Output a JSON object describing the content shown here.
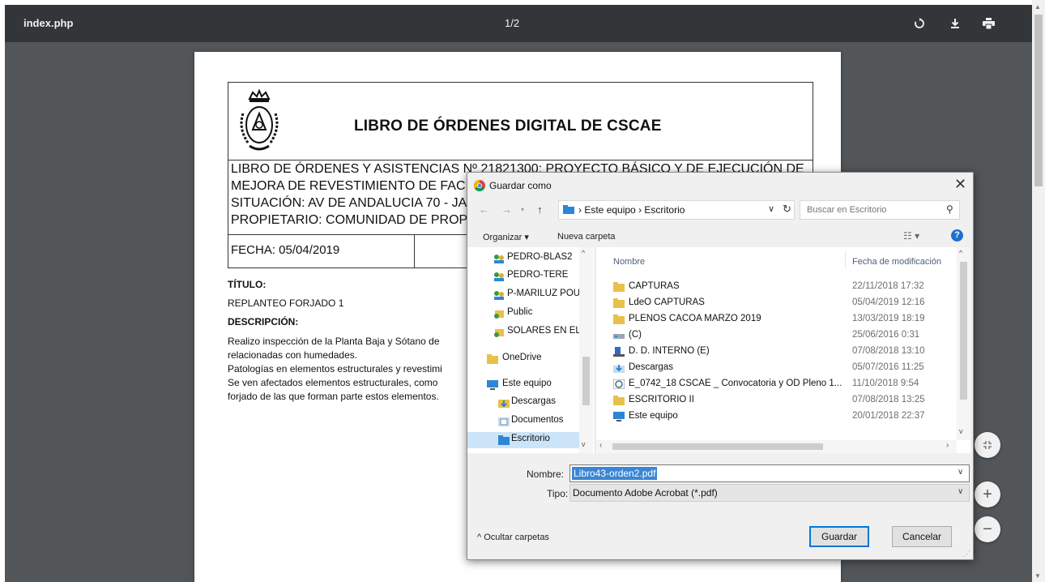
{
  "viewer": {
    "title": "index.php",
    "page_counter": "1/2",
    "rotate_icon": "rotate-icon",
    "download_icon": "download-icon",
    "print_icon": "print-icon"
  },
  "document": {
    "heading": "LIBRO DE ÓRDENES DIGITAL DE CSCAE",
    "meta_lines": [
      "LIBRO DE ÓRDENES Y ASISTENCIAS Nº 21821300: PROYECTO BÁSICO Y DE EJECUCIÓN DE",
      "MEJORA DE REVESTIMIENTO DE FAC",
      "SITUACIÓN: AV DE ANDALUCIA 70 - JA",
      "PROPIETARIO: COMUNIDAD DE PROP"
    ],
    "fecha": "FECHA: 05/04/2019",
    "titulo_label": "TÍTULO:",
    "titulo_value": "REPLANTEO FORJADO 1",
    "descripcion_label": "DESCRIPCIÓN:",
    "descripcion_lines": [
      "Realizo inspección de la Planta Baja y Sótano de",
      "relacionadas con humedades.",
      "Patologías en elementos estructurales y revestimi",
      "Se ven afectados elementos estructurales, como",
      "forjado de las que forman parte estos elementos."
    ]
  },
  "dialog": {
    "title": "Guardar como",
    "address": {
      "segments": [
        "Este equipo",
        "Escritorio"
      ]
    },
    "search_placeholder": "Buscar en Escritorio",
    "organizar": "Organizar ▾",
    "nueva_carpeta": "Nueva carpeta",
    "nav_items": [
      {
        "label": "PEDRO-BLAS2",
        "icon": "network-folder-icon"
      },
      {
        "label": "PEDRO-TERE",
        "icon": "network-folder-icon"
      },
      {
        "label": "P-MARILUZ POU",
        "icon": "network-folder-icon"
      },
      {
        "label": "Public",
        "icon": "shared-folder-icon"
      },
      {
        "label": "SOLARES EN EL",
        "icon": "shared-folder-icon"
      },
      {
        "label": "OneDrive",
        "icon": "folder-icon"
      },
      {
        "label": "Este equipo",
        "icon": "computer-icon"
      },
      {
        "label": "Descargas",
        "icon": "download-folder-icon"
      },
      {
        "label": "Documentos",
        "icon": "documents-folder-icon"
      },
      {
        "label": "Escritorio",
        "icon": "desktop-folder-icon"
      }
    ],
    "columns": {
      "name": "Nombre",
      "date": "Fecha de modificación"
    },
    "files": [
      {
        "name": "CAPTURAS",
        "date": "22/11/2018 17:32",
        "icon": "shortcut-folder-icon"
      },
      {
        "name": "LdeO CAPTURAS",
        "date": "05/04/2019 12:16",
        "icon": "shortcut-folder-icon"
      },
      {
        "name": "PLENOS CACOA MARZO 2019",
        "date": "13/03/2019 18:19",
        "icon": "shortcut-folder-icon"
      },
      {
        "name": "(C)",
        "date": "25/06/2016 0:31",
        "icon": "drive-shortcut-icon"
      },
      {
        "name": "D. D. INTERNO (E)",
        "date": "07/08/2018 13:10",
        "icon": "drive-shortcut-icon"
      },
      {
        "name": "Descargas",
        "date": "05/07/2016 11:25",
        "icon": "download-shortcut-icon"
      },
      {
        "name": "E_0742_18 CSCAE _ Convocatoria y OD Pleno 1...",
        "date": "11/10/2018 9:54",
        "icon": "chrome-shortcut-icon"
      },
      {
        "name": "ESCRITORIO II",
        "date": "07/08/2018 13:25",
        "icon": "shortcut-folder-icon"
      },
      {
        "name": "Este equipo",
        "date": "20/01/2018 22:37",
        "icon": "computer-shortcut-icon"
      }
    ],
    "nombre_label": "Nombre:",
    "nombre_value": "Libro43-orden2.pdf",
    "tipo_label": "Tipo:",
    "tipo_value": "Documento Adobe Acrobat (*.pdf)",
    "ocultar": "Ocultar carpetas",
    "guardar": "Guardar",
    "cancelar": "Cancelar"
  }
}
